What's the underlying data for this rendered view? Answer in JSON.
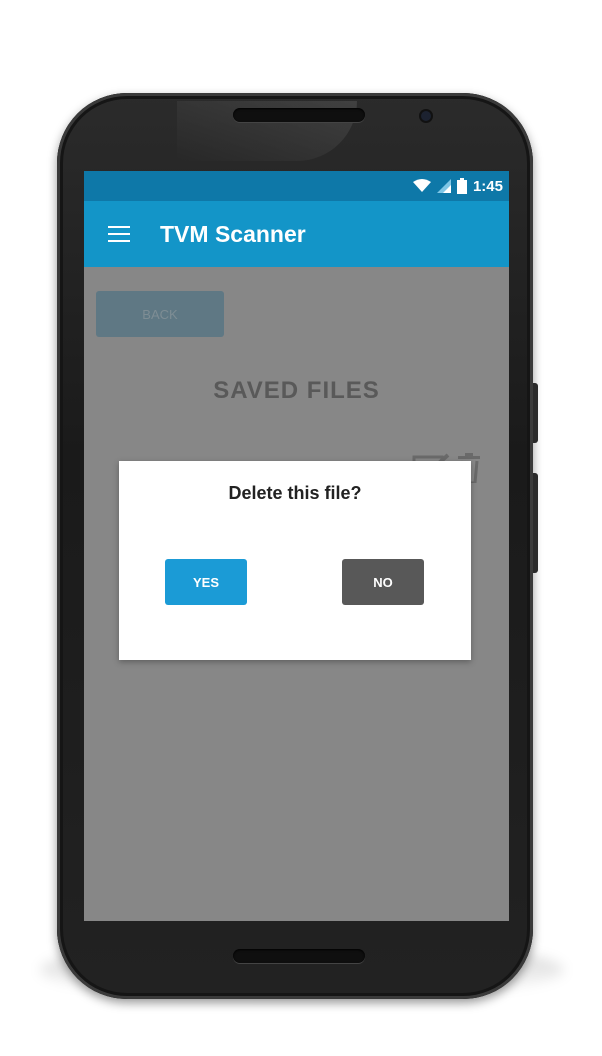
{
  "status_bar": {
    "time": "1:45",
    "icons": [
      "wifi-icon",
      "signal-icon",
      "battery-icon"
    ]
  },
  "app_bar": {
    "title": "TVM Scanner",
    "menu_icon": "hamburger-menu-icon"
  },
  "main": {
    "back_label": "BACK",
    "section_title": "SAVED  FILES",
    "file_row_icons": [
      "edit-icon",
      "trash-icon"
    ]
  },
  "dialog": {
    "message": "Delete this file?",
    "yes_label": "YES",
    "no_label": "NO"
  },
  "colors": {
    "status_bar": "#0e78a8",
    "app_bar": "#1395c8",
    "yes_button": "#1b9bd6",
    "no_button": "#585858",
    "scrim_background": "#878787"
  }
}
